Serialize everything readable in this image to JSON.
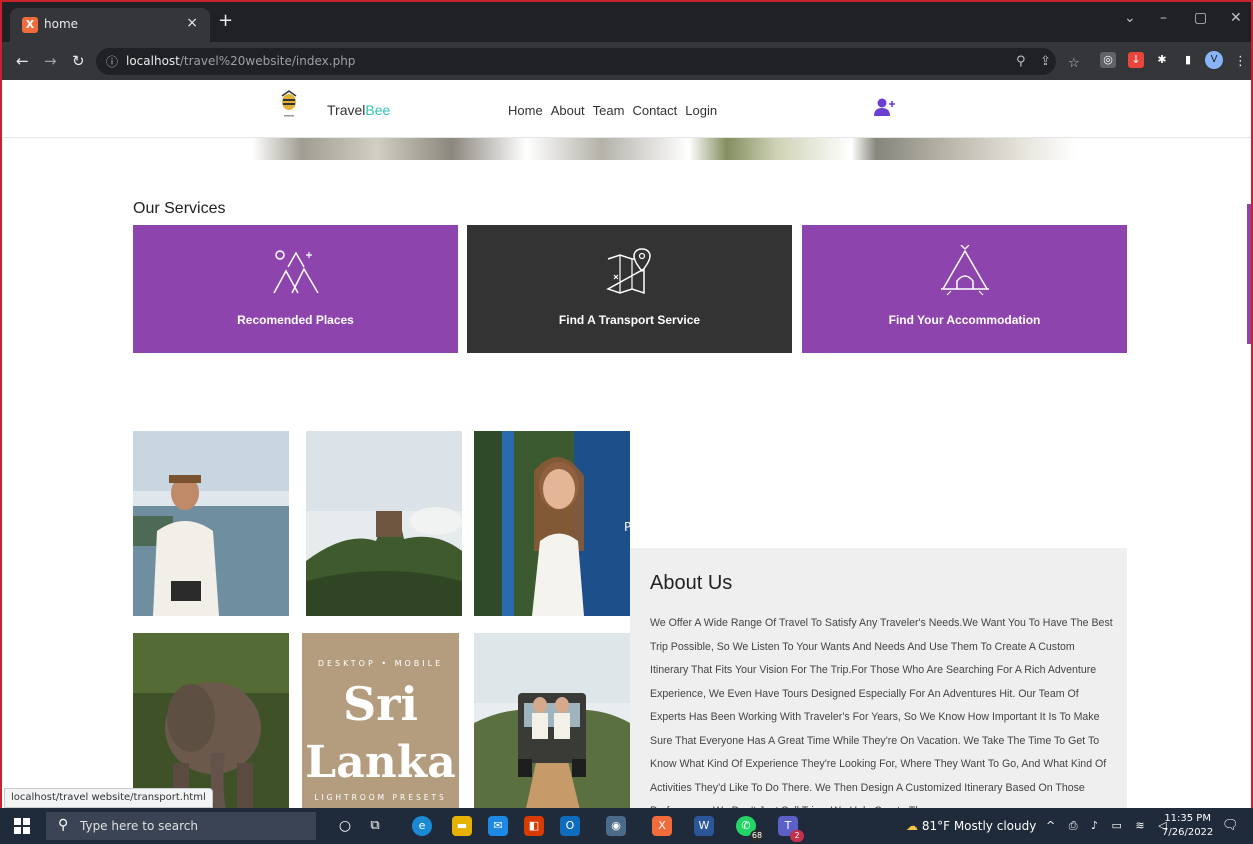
{
  "browser": {
    "tab_title": "home",
    "tab_favicon": "xampp-icon",
    "new_tab_symbol": "+",
    "url_host": "localhost",
    "url_path": "/travel%20website/index.php",
    "profile_initial": "V"
  },
  "site": {
    "brand_travel": "Travel",
    "brand_bee": "Bee",
    "nav": [
      "Home",
      "About",
      "Team",
      "Contact",
      "Login"
    ],
    "colors": {
      "purple": "#8e44ad",
      "dark": "#333333",
      "teal": "#2ec4b6"
    }
  },
  "services": {
    "title": "Our Services",
    "items": [
      {
        "label": "Recomended Places",
        "icon": "mountains-icon",
        "color": "#8e44ad"
      },
      {
        "label": "Find A Transport Service",
        "icon": "map-pin-icon",
        "color": "#333333"
      },
      {
        "label": "Find Your Accommodation",
        "icon": "tent-icon",
        "color": "#8e44ad"
      }
    ]
  },
  "gallery": {
    "poster_top": "DESKTOP • MOBILE",
    "poster_line1": "Sri",
    "poster_line2": "Lanka",
    "poster_bottom": "LIGHTROOM PRESETS",
    "train_side_letter": "P"
  },
  "about": {
    "title": "About Us",
    "body": "We Offer A Wide Range Of Travel To Satisfy Any Traveler's Needs.We Want You To Have The Best Trip Possible, So We Listen To Your Wants And Needs And Use Them To Create A Custom Itinerary That Fits Your Vision For The Trip.For Those Who Are Searching For A Rich Adventure Experience, We Even Have Tours Designed Especially For An Adventures Hit. Our Team Of Experts Has Been Working With Traveler's For Years, So We Know How Important It Is To Make Sure That Everyone Has A Great Time While They're On Vacation. We Take The Time To Get To Know What Kind Of Experience They're Looking For, Where They Want To Go, And What Kind Of Activities They'd Like To Do There. We Then Design A Customized Itinerary Based On Those Preferences. We Don't Just Sell Trips; We Help Create Them."
  },
  "status_bar": "localhost/travel website/transport.html",
  "taskbar": {
    "search_placeholder": "Type here to search",
    "whatsapp_badge": "68",
    "teams_badge": "2",
    "weather": "81°F  Mostly cloudy",
    "time": "11:35 PM",
    "date": "7/26/2022"
  }
}
